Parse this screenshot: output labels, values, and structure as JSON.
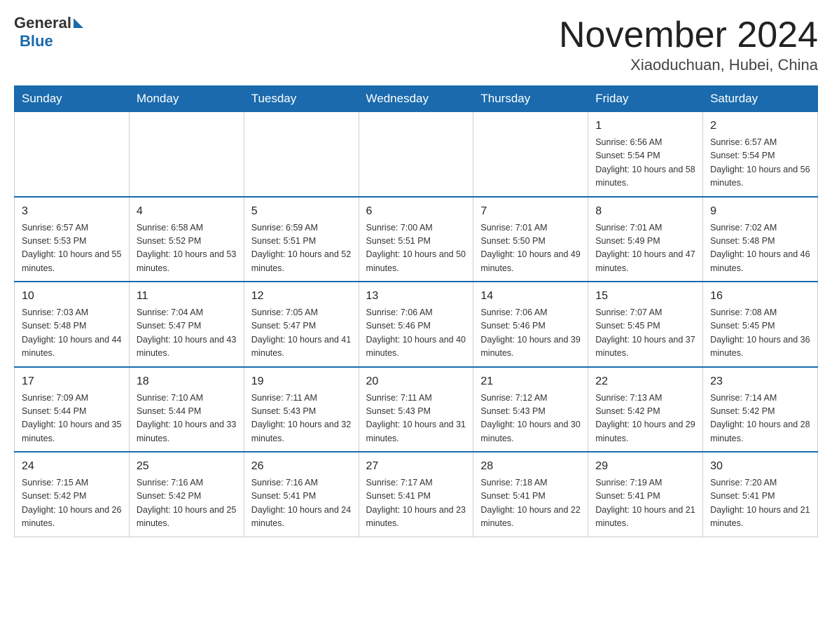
{
  "logo": {
    "general": "General",
    "blue": "Blue"
  },
  "title": {
    "month_year": "November 2024",
    "location": "Xiaoduchuan, Hubei, China"
  },
  "weekdays": [
    "Sunday",
    "Monday",
    "Tuesday",
    "Wednesday",
    "Thursday",
    "Friday",
    "Saturday"
  ],
  "weeks": [
    [
      {
        "day": "",
        "info": ""
      },
      {
        "day": "",
        "info": ""
      },
      {
        "day": "",
        "info": ""
      },
      {
        "day": "",
        "info": ""
      },
      {
        "day": "",
        "info": ""
      },
      {
        "day": "1",
        "info": "Sunrise: 6:56 AM\nSunset: 5:54 PM\nDaylight: 10 hours and 58 minutes."
      },
      {
        "day": "2",
        "info": "Sunrise: 6:57 AM\nSunset: 5:54 PM\nDaylight: 10 hours and 56 minutes."
      }
    ],
    [
      {
        "day": "3",
        "info": "Sunrise: 6:57 AM\nSunset: 5:53 PM\nDaylight: 10 hours and 55 minutes."
      },
      {
        "day": "4",
        "info": "Sunrise: 6:58 AM\nSunset: 5:52 PM\nDaylight: 10 hours and 53 minutes."
      },
      {
        "day": "5",
        "info": "Sunrise: 6:59 AM\nSunset: 5:51 PM\nDaylight: 10 hours and 52 minutes."
      },
      {
        "day": "6",
        "info": "Sunrise: 7:00 AM\nSunset: 5:51 PM\nDaylight: 10 hours and 50 minutes."
      },
      {
        "day": "7",
        "info": "Sunrise: 7:01 AM\nSunset: 5:50 PM\nDaylight: 10 hours and 49 minutes."
      },
      {
        "day": "8",
        "info": "Sunrise: 7:01 AM\nSunset: 5:49 PM\nDaylight: 10 hours and 47 minutes."
      },
      {
        "day": "9",
        "info": "Sunrise: 7:02 AM\nSunset: 5:48 PM\nDaylight: 10 hours and 46 minutes."
      }
    ],
    [
      {
        "day": "10",
        "info": "Sunrise: 7:03 AM\nSunset: 5:48 PM\nDaylight: 10 hours and 44 minutes."
      },
      {
        "day": "11",
        "info": "Sunrise: 7:04 AM\nSunset: 5:47 PM\nDaylight: 10 hours and 43 minutes."
      },
      {
        "day": "12",
        "info": "Sunrise: 7:05 AM\nSunset: 5:47 PM\nDaylight: 10 hours and 41 minutes."
      },
      {
        "day": "13",
        "info": "Sunrise: 7:06 AM\nSunset: 5:46 PM\nDaylight: 10 hours and 40 minutes."
      },
      {
        "day": "14",
        "info": "Sunrise: 7:06 AM\nSunset: 5:46 PM\nDaylight: 10 hours and 39 minutes."
      },
      {
        "day": "15",
        "info": "Sunrise: 7:07 AM\nSunset: 5:45 PM\nDaylight: 10 hours and 37 minutes."
      },
      {
        "day": "16",
        "info": "Sunrise: 7:08 AM\nSunset: 5:45 PM\nDaylight: 10 hours and 36 minutes."
      }
    ],
    [
      {
        "day": "17",
        "info": "Sunrise: 7:09 AM\nSunset: 5:44 PM\nDaylight: 10 hours and 35 minutes."
      },
      {
        "day": "18",
        "info": "Sunrise: 7:10 AM\nSunset: 5:44 PM\nDaylight: 10 hours and 33 minutes."
      },
      {
        "day": "19",
        "info": "Sunrise: 7:11 AM\nSunset: 5:43 PM\nDaylight: 10 hours and 32 minutes."
      },
      {
        "day": "20",
        "info": "Sunrise: 7:11 AM\nSunset: 5:43 PM\nDaylight: 10 hours and 31 minutes."
      },
      {
        "day": "21",
        "info": "Sunrise: 7:12 AM\nSunset: 5:43 PM\nDaylight: 10 hours and 30 minutes."
      },
      {
        "day": "22",
        "info": "Sunrise: 7:13 AM\nSunset: 5:42 PM\nDaylight: 10 hours and 29 minutes."
      },
      {
        "day": "23",
        "info": "Sunrise: 7:14 AM\nSunset: 5:42 PM\nDaylight: 10 hours and 28 minutes."
      }
    ],
    [
      {
        "day": "24",
        "info": "Sunrise: 7:15 AM\nSunset: 5:42 PM\nDaylight: 10 hours and 26 minutes."
      },
      {
        "day": "25",
        "info": "Sunrise: 7:16 AM\nSunset: 5:42 PM\nDaylight: 10 hours and 25 minutes."
      },
      {
        "day": "26",
        "info": "Sunrise: 7:16 AM\nSunset: 5:41 PM\nDaylight: 10 hours and 24 minutes."
      },
      {
        "day": "27",
        "info": "Sunrise: 7:17 AM\nSunset: 5:41 PM\nDaylight: 10 hours and 23 minutes."
      },
      {
        "day": "28",
        "info": "Sunrise: 7:18 AM\nSunset: 5:41 PM\nDaylight: 10 hours and 22 minutes."
      },
      {
        "day": "29",
        "info": "Sunrise: 7:19 AM\nSunset: 5:41 PM\nDaylight: 10 hours and 21 minutes."
      },
      {
        "day": "30",
        "info": "Sunrise: 7:20 AM\nSunset: 5:41 PM\nDaylight: 10 hours and 21 minutes."
      }
    ]
  ]
}
